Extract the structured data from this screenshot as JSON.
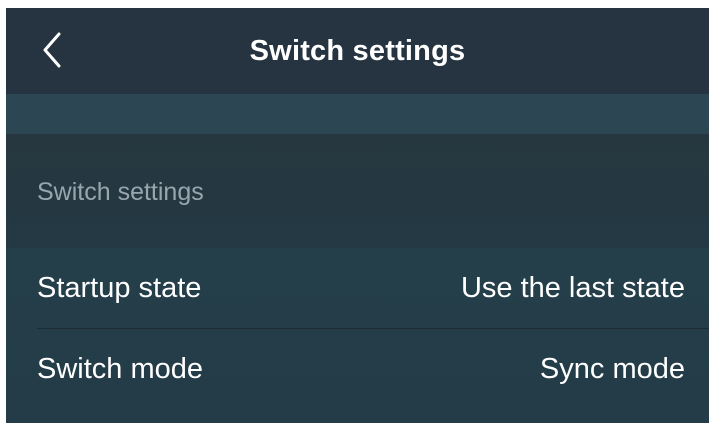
{
  "nav": {
    "back_icon": "chevron-left-icon",
    "title": "Switch settings"
  },
  "section": {
    "header": "Switch settings"
  },
  "rows": [
    {
      "label": "Startup state",
      "value": "Use the last state"
    },
    {
      "label": "Switch mode",
      "value": "Sync mode"
    }
  ],
  "colors": {
    "nav_background": "#253440",
    "band_background": "#2c4653",
    "list_background": "#233c48",
    "primary_text": "#ffffff",
    "secondary_text": "#9aa6ad"
  }
}
